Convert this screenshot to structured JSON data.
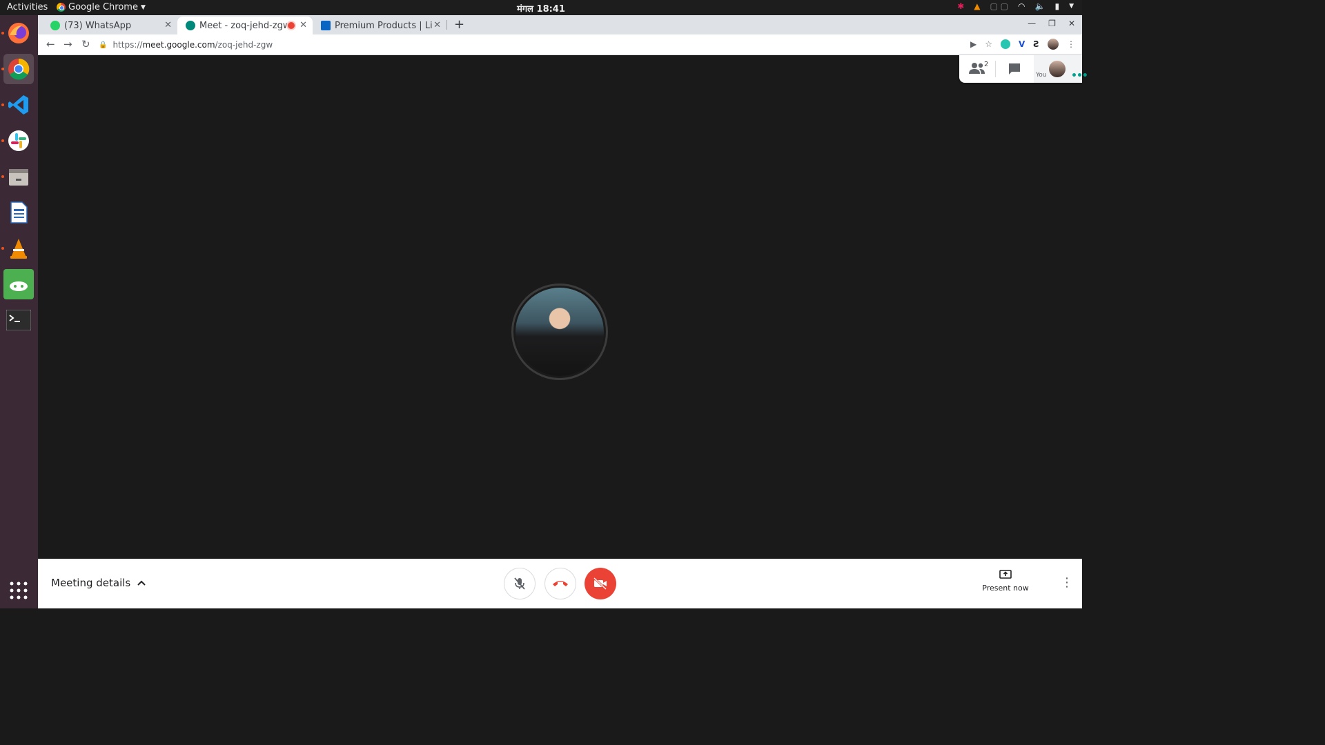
{
  "topbar": {
    "activities": "Activities",
    "app_name": "Google Chrome",
    "clock": "मंगल 18:41"
  },
  "tabs": [
    {
      "title": "(73) WhatsApp",
      "favicon": "whatsapp-icon",
      "color": "#25d366"
    },
    {
      "title": "Meet - zoq-jehd-zgw",
      "favicon": "meet-icon",
      "color": "#00897b",
      "recording": true
    },
    {
      "title": "Premium Products | Linke",
      "favicon": "linkedin-icon",
      "color": "#0a66c2"
    }
  ],
  "address": {
    "scheme": "https://",
    "host": "meet.google.com",
    "path": "/zoq-jehd-zgw"
  },
  "meet": {
    "participant_count": "2",
    "self_label": "You",
    "meeting_details": "Meeting details",
    "present_now": "Present now"
  },
  "colors": {
    "stage_bg": "#1a1a1a",
    "hangup_red": "#ea4335",
    "dock_bg": "#3b2a35",
    "accent_orange": "#e95420"
  },
  "dock": [
    "firefox-icon",
    "chrome-icon",
    "vscode-icon",
    "slack-icon",
    "files-icon",
    "writer-icon",
    "vlc-icon",
    "snap-store-icon",
    "terminal-icon",
    "show-apps-icon"
  ]
}
